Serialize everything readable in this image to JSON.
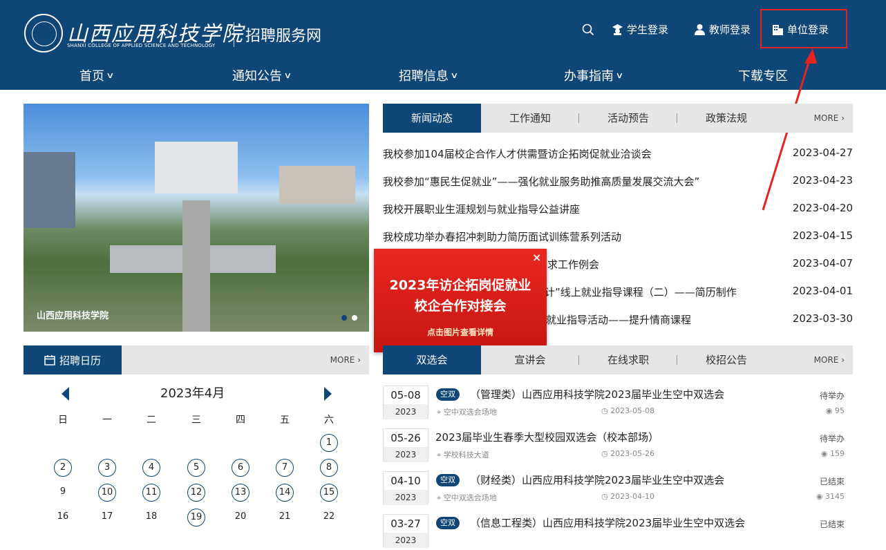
{
  "header": {
    "logo_cn": "山西应用科技学院",
    "logo_en": "SHANXI COLLEGE OF APPLIED SCIENCE AND TECHNOLOGY",
    "site_name": "招聘服务网",
    "login_student": "学生登录",
    "login_teacher": "教师登录",
    "login_company": "单位登录"
  },
  "nav": [
    "首页",
    "通知公告",
    "招聘信息",
    "办事指南",
    "下载专区"
  ],
  "hero": {
    "caption": "山西应用科技学院"
  },
  "news_tabs": {
    "tabs": [
      "新闻动态",
      "工作通知",
      "活动预告",
      "政策法规"
    ],
    "more": "MORE"
  },
  "news": [
    {
      "title": "我校参加104届校企合作人才供需暨访企拓岗促就业洽谈会",
      "date": "2023-04-27"
    },
    {
      "title": "我校参加“惠民生促就业”——强化就业服务助推高质量发展交流大会”",
      "date": "2023-04-23"
    },
    {
      "title": "我校开展职业生涯规划与就业指导公益讲座",
      "date": "2023-04-20"
    },
    {
      "title": "我校成功举办春招冲刺助力简历面试训练营系列活动",
      "date": "2023-04-15"
    },
    {
      "title": "求工作例会",
      "date": "2023-04-07"
    },
    {
      "title": "计”线上就业指导课程（二）——简历制作",
      "date": "2023-04-01"
    },
    {
      "title": "就业指导活动——提升情商课程",
      "date": "2023-03-30"
    }
  ],
  "popup": {
    "line1": "2023年访企拓岗促就业",
    "line2": "校企合作对接会",
    "sub": "点击图片查看详情",
    "close": "×"
  },
  "calendar": {
    "tab": "招聘日历",
    "more": "MORE",
    "month": "2023年4月",
    "weekdays": [
      "日",
      "一",
      "二",
      "三",
      "四",
      "五",
      "六"
    ],
    "rows": [
      [
        "",
        "",
        "",
        "",
        "",
        "",
        "1"
      ],
      [
        "2",
        "3",
        "4",
        "5",
        "6",
        "7",
        "8"
      ],
      [
        "9",
        "10",
        "11",
        "12",
        "13",
        "14",
        "15"
      ],
      [
        "16",
        "17",
        "18",
        "19",
        "20",
        "21",
        "22"
      ]
    ],
    "circled": [
      "1",
      "2",
      "3",
      "4",
      "5",
      "6",
      "7",
      "8",
      "10",
      "11",
      "12",
      "13",
      "14",
      "15",
      "19"
    ]
  },
  "jobs_tabs": {
    "tabs": [
      "双选会",
      "宣讲会",
      "在线求职",
      "校招公告"
    ],
    "more": "MORE"
  },
  "jobs": [
    {
      "md": "05-08",
      "year": "2023",
      "badge": "空双",
      "title": "（管理类）山西应用科技学院2023届毕业生空中双选会",
      "status": "待举办",
      "place": "空中双选会场地",
      "date": "2023-05-08",
      "views": "95"
    },
    {
      "md": "05-26",
      "year": "2023",
      "badge": "",
      "title": "2023届毕业生春季大型校园双选会（校本部场）",
      "status": "待举办",
      "place": "学校科技大道",
      "date": "2023-05-26",
      "views": "159"
    },
    {
      "md": "04-10",
      "year": "2023",
      "badge": "空双",
      "title": "（财经类）山西应用科技学院2023届毕业生空中双选会",
      "status": "已结束",
      "place": "空中双选会场地",
      "date": "2023-04-10",
      "views": "3145"
    },
    {
      "md": "03-27",
      "year": "2023",
      "badge": "空双",
      "title": "（信息工程类）山西应用科技学院2023届毕业生空中双选会",
      "status": "已结束",
      "place": "",
      "date": "",
      "views": ""
    }
  ],
  "colors": {
    "brand": "#0e4677",
    "highlight": "#e52420"
  }
}
